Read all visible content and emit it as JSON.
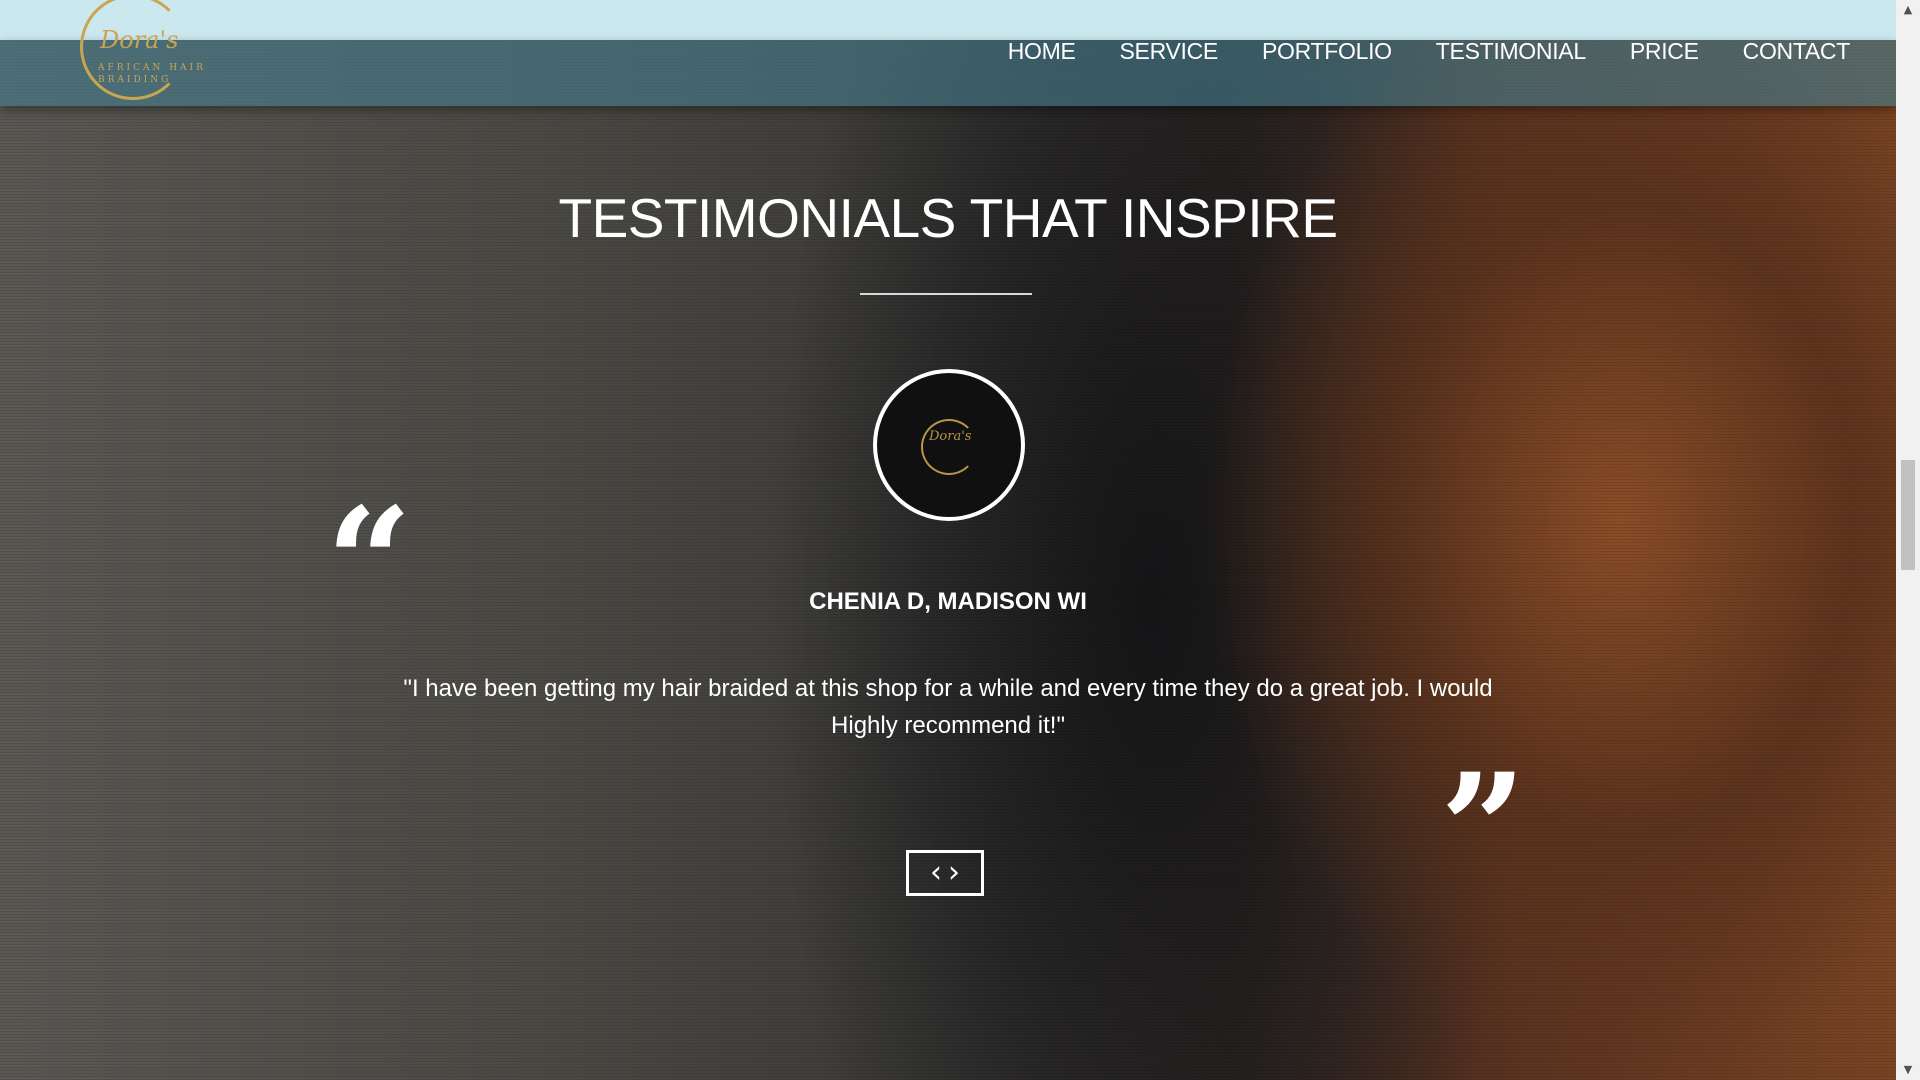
{
  "brand": {
    "logo_script": "Dora's",
    "logo_sub": "AFRICAN HAIR\nBRAIDING",
    "accent_color": "#c9a552"
  },
  "nav": {
    "items": [
      {
        "label": "HOME"
      },
      {
        "label": "SERVICE"
      },
      {
        "label": "PORTFOLIO"
      },
      {
        "label": "TESTIMONIAL"
      },
      {
        "label": "PRICE"
      },
      {
        "label": "CONTACT"
      }
    ]
  },
  "section": {
    "title": "TESTIMONIALS THAT INSPIRE"
  },
  "testimonial": {
    "avatar_script": "Dora's",
    "open_quote": "“",
    "close_quote": "”",
    "name": "CHENIA D, MADISON WI",
    "text": "\"I have been getting my hair braided at this shop for a while and every time they do a great job. I would Highly recommend it!\""
  },
  "carousel": {
    "prev_icon": "chevron-left-icon",
    "next_icon": "chevron-right-icon",
    "prev_glyph": "‹",
    "next_glyph": "›"
  },
  "scrollbar": {
    "up_glyph": "▲",
    "down_glyph": "▼"
  },
  "colors": {
    "top_strip": "#cbe8ef",
    "navbar": "#467d8c"
  }
}
